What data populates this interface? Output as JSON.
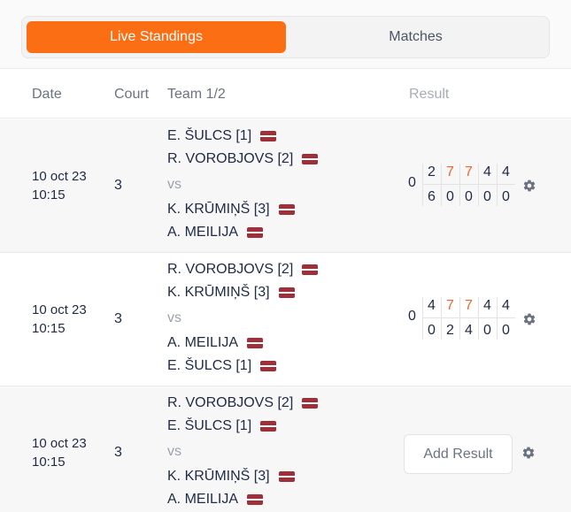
{
  "tabs": {
    "live_standings": "Live Standings",
    "matches": "Matches"
  },
  "table_header": {
    "date": "Date",
    "court": "Court",
    "team": "Team 1/2",
    "result": "Result"
  },
  "vs_label": "vs",
  "add_result_label": "Add Result",
  "colors": {
    "accent": "#fb6e14",
    "highlight_score": "#f0642d",
    "flag": "#9e3039"
  },
  "matches": [
    {
      "date": "10 oct 23",
      "time": "10:15",
      "court": "3",
      "team1": [
        "E. ŠULCS [1]",
        "R. VOROBJOVS [2]"
      ],
      "team2": [
        "K. KRŪMIŅŠ [3]",
        "A. MEILIJA"
      ],
      "total": "0",
      "sets_top": [
        "2",
        "7",
        "7",
        "4",
        "4"
      ],
      "sets_bottom": [
        "6",
        "0",
        "0",
        "0",
        "0"
      ],
      "highlight": [
        false,
        true,
        true,
        false,
        false
      ]
    },
    {
      "date": "10 oct 23",
      "time": "10:15",
      "court": "3",
      "team1": [
        "R. VOROBJOVS [2]",
        "K. KRŪMIŅŠ [3]"
      ],
      "team2": [
        "A. MEILIJA",
        "E. ŠULCS [1]"
      ],
      "total": "0",
      "sets_top": [
        "4",
        "7",
        "7",
        "4",
        "4"
      ],
      "sets_bottom": [
        "0",
        "2",
        "4",
        "0",
        "0"
      ],
      "highlight": [
        false,
        true,
        true,
        false,
        false
      ]
    },
    {
      "date": "10 oct 23",
      "time": "10:15",
      "court": "3",
      "team1": [
        "R. VOROBJOVS [2]",
        "E. ŠULCS [1]"
      ],
      "team2": [
        "K. KRŪMIŅŠ [3]",
        "A. MEILIJA"
      ]
    }
  ]
}
